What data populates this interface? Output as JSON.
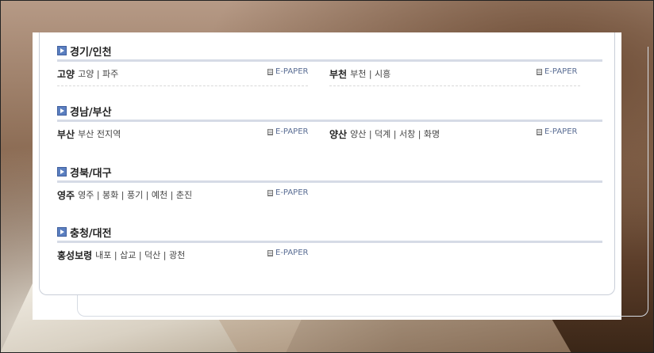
{
  "sections": [
    {
      "title": "경기/인천",
      "entries": [
        {
          "name": "고양",
          "sub": "고양 | 파주",
          "epaper": "E-PAPER"
        },
        {
          "name": "부천",
          "sub": "부천 | 시흥",
          "epaper": "E-PAPER"
        }
      ]
    },
    {
      "title": "경남/부산",
      "entries": [
        {
          "name": "부산",
          "sub": "부산 전지역",
          "epaper": "E-PAPER"
        },
        {
          "name": "양산",
          "sub": "양산 | 덕계 | 서창 | 화명",
          "epaper": "E-PAPER"
        }
      ]
    },
    {
      "title": "경북/대구",
      "entries": [
        {
          "name": "영주",
          "sub": "영주 | 봉화 | 풍기 | 예천 | 춘진",
          "epaper": "E-PAPER"
        }
      ]
    },
    {
      "title": "충청/대전",
      "entries": [
        {
          "name": "홍성보령",
          "sub": "내포 | 삽교 | 덕산 | 광천",
          "epaper": "E-PAPER"
        }
      ]
    }
  ],
  "colors": {
    "section_icon": "#5b7fc0",
    "epaper_link": "#5a6d94",
    "divider": "#d6dbe6"
  },
  "icons": {
    "section_marker": "play-arrow-icon",
    "epaper_marker": "document-icon"
  }
}
